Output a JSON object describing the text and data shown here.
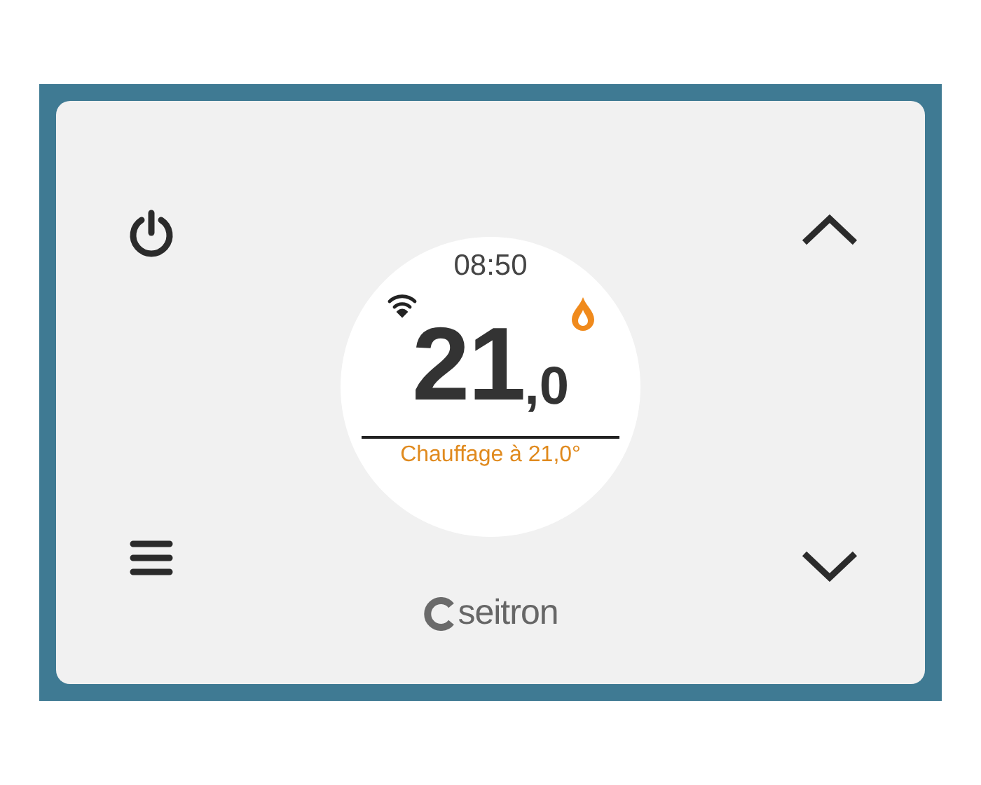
{
  "display": {
    "time": "08:50",
    "heating": true,
    "temperature_whole": "21",
    "temperature_decimal": ",0",
    "status": "Chauffage à 21,0°"
  },
  "brand": "seitron"
}
